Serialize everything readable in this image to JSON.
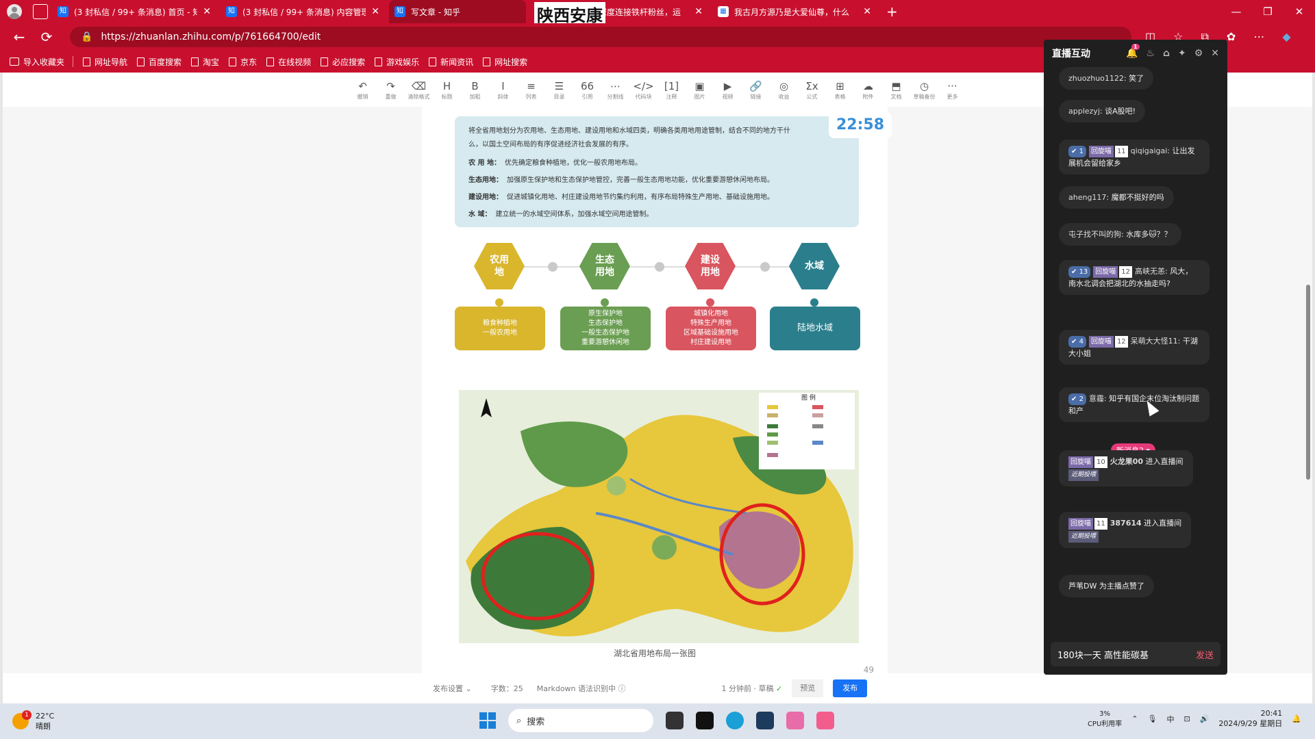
{
  "browser": {
    "tabs": [
      {
        "title": "(3 封私信 / 99+ 条消息) 首页 - 知",
        "icon": "知",
        "active": false
      },
      {
        "title": "(3 封私信 / 99+ 条消息) 内容管理",
        "icon": "知",
        "active": false
      },
      {
        "title": "写文章 - 知乎",
        "icon": "知",
        "active": true
      },
      {
        "title": "深度连接铁杆粉丝，运",
        "icon": "知",
        "active": false
      },
      {
        "title": "我古月方源乃是大爱仙尊，什么",
        "icon": "cal",
        "active": false
      }
    ],
    "overlay_text": "陕西安康",
    "url": "https://zhuanlan.zhihu.com/p/761664700/edit",
    "bookmarks": [
      "导入收藏夹",
      "网址导航",
      "百度搜索",
      "淘宝",
      "京东",
      "在线视频",
      "必应搜索",
      "游戏娱乐",
      "新闻资讯",
      "网址搜索"
    ]
  },
  "toolbar": {
    "items": [
      {
        "icon": "↶",
        "label": "撤销"
      },
      {
        "icon": "↷",
        "label": "重做"
      },
      {
        "icon": "⌫",
        "label": "清除格式"
      },
      {
        "icon": "H",
        "label": "标题"
      },
      {
        "icon": "B",
        "label": "加粗"
      },
      {
        "icon": "I",
        "label": "斜体"
      },
      {
        "icon": "≡",
        "label": "列表"
      },
      {
        "icon": "☰",
        "label": "目录"
      },
      {
        "icon": "66",
        "label": "引用"
      },
      {
        "icon": "⋯",
        "label": "分割线"
      },
      {
        "icon": "</>",
        "label": "代码块"
      },
      {
        "icon": "[1]",
        "label": "注释"
      },
      {
        "icon": "▣",
        "label": "图片"
      },
      {
        "icon": "▶",
        "label": "视频"
      },
      {
        "icon": "🔗",
        "label": "链接"
      },
      {
        "icon": "◎",
        "label": "收益"
      },
      {
        "icon": "Σx",
        "label": "公式"
      },
      {
        "icon": "⊞",
        "label": "表格"
      },
      {
        "icon": "☁",
        "label": "附件"
      },
      {
        "icon": "⬒",
        "label": "文档"
      },
      {
        "icon": "◷",
        "label": "草稿备份"
      },
      {
        "icon": "···",
        "label": "更多"
      }
    ]
  },
  "document": {
    "timer": "22:58",
    "intro": "将全省用地划分为农用地、生态用地、建设用地和水域四类，明确各类用地用途管制，结合不同的地方干什么，以国土空间布局的有序促进经济社会发展的有序。",
    "rows": [
      {
        "k": "农 用 地：",
        "v": "优先确定粮食种植地，优化一般农用地布局。"
      },
      {
        "k": "生态用地：",
        "v": "加强原生保护地和生态保护地管控，完善一般生态用地功能，优化重要游憩休闲地布局。"
      },
      {
        "k": "建设用地：",
        "v": "促进城镇化用地、村庄建设用地节约集约利用，有序布局特殊生产用地、基础设施用地。"
      },
      {
        "k": "水    域：",
        "v": "建立统一的水域空间体系，加强水域空间用途管制。"
      }
    ],
    "categories": [
      {
        "name": "农用地",
        "color": "#d9b62c",
        "detail": "粮食种植地\n一般农用地"
      },
      {
        "name": "生态用地",
        "color": "#6a9e52",
        "detail": "原生保护地\n生态保护地\n一般生态保护地\n重要游憩休闲地"
      },
      {
        "name": "建设用地",
        "color": "#d9555f",
        "detail": "城镇化用地\n特殊生产用地\n区域基础设施用地\n村庄建设用地"
      },
      {
        "name": "水域",
        "color": "#2b7f8c",
        "detail": "陆地水域"
      }
    ],
    "map_legend_title": "图 例",
    "map_caption": "湖北省用地布局一张图",
    "page_number": "49"
  },
  "docbar": {
    "settings": "发布设置",
    "wordcount": "字数：25",
    "markdown": "Markdown 语法识别中",
    "saved": "1 分钟前 · 草稿",
    "preview": "预览",
    "publish": "发布"
  },
  "live": {
    "title": "直播互动",
    "notif_count": "1",
    "messages": [
      {
        "user": "zhuozhuo1122:",
        "text": " 笑了",
        "badges": null
      },
      {
        "user": "applezyj:",
        "text": " 谈A股吧!",
        "badges": null
      },
      {
        "user": "qiqigaigai:",
        "text": " 让出发展机会留给家乡",
        "v": "1",
        "fan": "回旋喵",
        "level": "11"
      },
      {
        "user": "aheng117:",
        "text": " 魔都不挺好的吗",
        "badges": null
      },
      {
        "user": "屯子找不叫的狗:",
        "text": " 水库多🐱？？",
        "badges": null
      },
      {
        "user": "高峡无恙:",
        "text": " 风大，南水北调会把湖北的水抽走吗?",
        "v": "13",
        "fan": "回旋喵",
        "level": "12"
      },
      {
        "user": "呆萌大大怪11:",
        "text": " 干湖大小姐",
        "v": "4",
        "fan": "回旋喵",
        "level": "12"
      },
      {
        "user": "意霾:",
        "text": " 知乎有国企末位淘汰制问题和产",
        "v": "2",
        "fan": "",
        "level": ""
      }
    ],
    "new_messages": "新消息2",
    "enter": [
      {
        "fan": "回旋喵",
        "level": "10",
        "user": "火龙果00",
        "text": " 进入直播间",
        "tag": "近期投喂"
      },
      {
        "fan": "回旋喵",
        "level": "11",
        "user": "387614",
        "text": " 进入直播间",
        "tag": "近期投喂"
      }
    ],
    "like": "芦苇DW 为主播点赞了",
    "input": "180块一天 高性能碳基",
    "send": "发送"
  },
  "taskbar": {
    "temp": "22°C",
    "weather": "晴朗",
    "weather_badge": "1",
    "search": "搜索",
    "cpu_value": "3%",
    "cpu_label": "CPU利用率",
    "ime": "中",
    "time": "20:41",
    "date": "2024/9/29 星期日"
  }
}
